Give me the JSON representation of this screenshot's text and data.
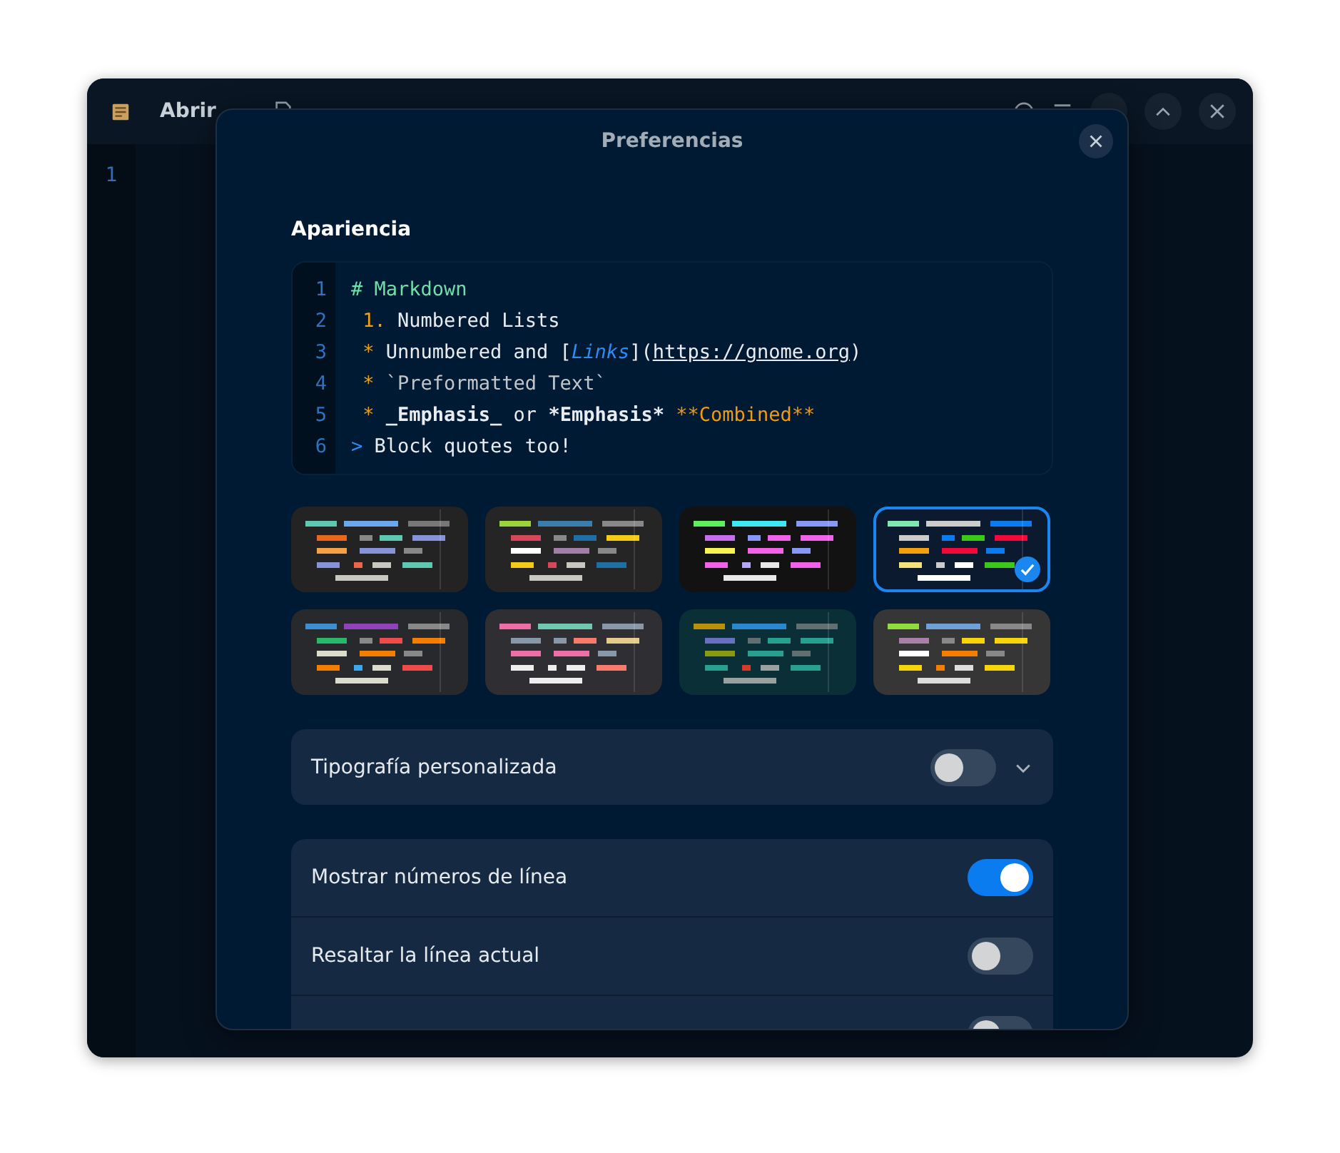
{
  "window": {
    "open_button": "Abrir",
    "line_numbers": [
      "1"
    ]
  },
  "dialog": {
    "title": "Preferencias"
  },
  "appearance": {
    "heading": "Apariencia",
    "preview_lines": [
      {
        "number": "1",
        "segments": [
          {
            "kind": "heading",
            "text": "# Markdown"
          }
        ]
      },
      {
        "number": "2",
        "segments": [
          {
            "kind": "marker",
            "text": " 1."
          },
          {
            "kind": "plain",
            "text": " Numbered Lists"
          }
        ]
      },
      {
        "number": "3",
        "segments": [
          {
            "kind": "marker",
            "text": " *"
          },
          {
            "kind": "plain",
            "text": " Unnumbered and ["
          },
          {
            "kind": "link",
            "text": "Links"
          },
          {
            "kind": "plain",
            "text": "]("
          },
          {
            "kind": "url",
            "text": "https://gnome.org"
          },
          {
            "kind": "plain",
            "text": ")"
          }
        ]
      },
      {
        "number": "4",
        "segments": [
          {
            "kind": "marker",
            "text": " *"
          },
          {
            "kind": "code",
            "text": " `Preformatted Text`"
          }
        ]
      },
      {
        "number": "5",
        "segments": [
          {
            "kind": "marker",
            "text": " *"
          },
          {
            "kind": "bold",
            "text": " _Emphasis_"
          },
          {
            "kind": "plain",
            "text": " or "
          },
          {
            "kind": "bold",
            "text": "*Emphasis*"
          },
          {
            "kind": "accent",
            "text": " **Combined**"
          }
        ]
      },
      {
        "number": "6",
        "segments": [
          {
            "kind": "quote",
            "text": ">"
          },
          {
            "kind": "plain",
            "text": " Block quotes too!"
          }
        ]
      }
    ],
    "themes": [
      {
        "color": "#232323",
        "selected": false
      },
      {
        "color": "#252525",
        "selected": false
      },
      {
        "color": "#121212",
        "selected": false
      },
      {
        "color": "#0b1a2e",
        "selected": true
      },
      {
        "color": "#27292c",
        "selected": false
      },
      {
        "color": "#2e2e33",
        "selected": false
      },
      {
        "color": "#0a2f36",
        "selected": false
      },
      {
        "color": "#363636",
        "selected": false
      }
    ]
  },
  "custom_font": {
    "label": "Tipografía personalizada",
    "on": false
  },
  "settings": [
    {
      "label": "Mostrar números de línea",
      "on": true
    },
    {
      "label": "Resaltar la línea actual",
      "on": false
    },
    {
      "on": false
    }
  ]
}
